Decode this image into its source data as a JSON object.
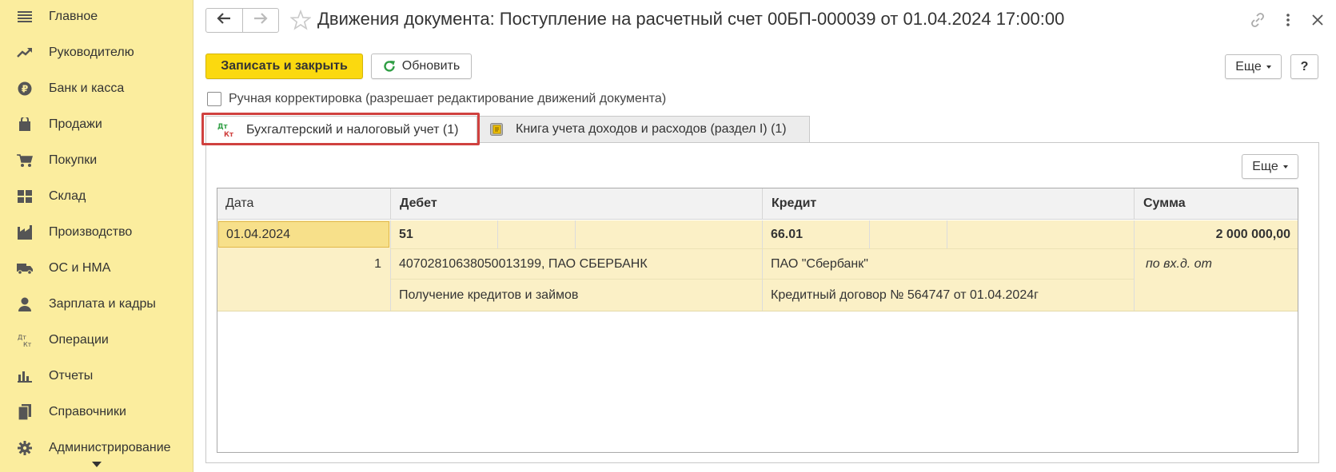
{
  "sidebar": {
    "items": [
      {
        "label": "Главное",
        "icon": "menu-icon"
      },
      {
        "label": "Руководителю",
        "icon": "trend-icon"
      },
      {
        "label": "Банк и касса",
        "icon": "ruble-coin-icon"
      },
      {
        "label": "Продажи",
        "icon": "shopping-bag-icon"
      },
      {
        "label": "Покупки",
        "icon": "cart-icon"
      },
      {
        "label": "Склад",
        "icon": "warehouse-grid-icon"
      },
      {
        "label": "Производство",
        "icon": "factory-icon"
      },
      {
        "label": "ОС и НМА",
        "icon": "truck-icon"
      },
      {
        "label": "Зарплата и кадры",
        "icon": "person-icon"
      },
      {
        "label": "Операции",
        "icon": "dt-kt-icon"
      },
      {
        "label": "Отчеты",
        "icon": "bar-chart-icon"
      },
      {
        "label": "Справочники",
        "icon": "books-icon"
      },
      {
        "label": "Администрирование",
        "icon": "gear-icon"
      }
    ]
  },
  "header": {
    "title": "Движения документа: Поступление на расчетный счет 00БП-000039 от 01.04.2024 17:00:00"
  },
  "toolbar": {
    "save_close_label": "Записать и закрыть",
    "refresh_label": "Обновить",
    "more_label": "Еще",
    "help_label": "?"
  },
  "manual_correction": {
    "label": "Ручная корректировка (разрешает редактирование движений документа)",
    "checked": false
  },
  "tabs": [
    {
      "label": "Бухгалтерский и налоговый учет (1)",
      "icon": "dt-kt-icon",
      "active": true
    },
    {
      "label": "Книга учета доходов и расходов (раздел I) (1)",
      "icon": "ledger-book-icon",
      "active": false
    }
  ],
  "table": {
    "more_label": "Еще",
    "columns": [
      "Дата",
      "Дебет",
      "Кредит",
      "Сумма"
    ],
    "rows": [
      {
        "date": "01.04.2024",
        "number": "1",
        "debit_account": "51",
        "debit_sub1": "40702810638050013199, ПАО СБЕРБАНК",
        "debit_sub2": "Получение кредитов и займов",
        "credit_account": "66.01",
        "credit_sub1": "ПАО \"Сбербанк\"",
        "credit_sub2": "Кредитный договор № 564747 от 01.04.2024г",
        "amount": "2 000 000,00",
        "note": "по вх.д.  от"
      }
    ]
  },
  "colors": {
    "sidebar_bg": "#fbed9e",
    "primary_button": "#fbd90f",
    "row_highlight": "#fbf0c6",
    "tab_outline": "#d0413f"
  }
}
